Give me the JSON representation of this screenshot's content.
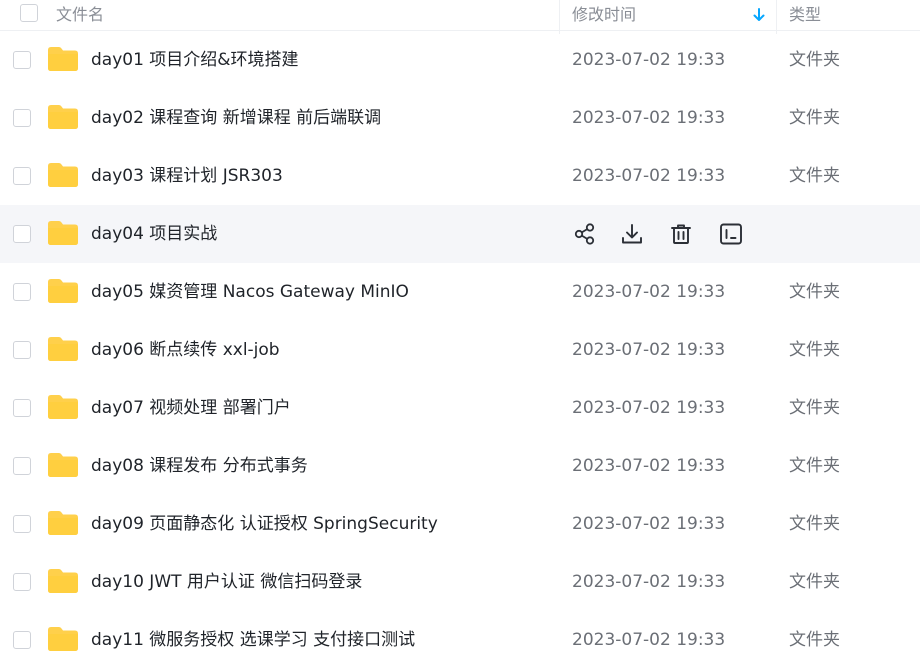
{
  "header": {
    "name_label": "文件名",
    "time_label": "修改时间",
    "type_label": "类型",
    "sort_icon": "arrow-down-icon",
    "accent": "#06a7ff"
  },
  "folder_color": "#ffd04b",
  "files": [
    {
      "name": "day01 项目介绍&环境搭建",
      "time": "2023-07-02 19:33",
      "type": "文件夹"
    },
    {
      "name": "day02 课程查询 新增课程 前后端联调",
      "time": "2023-07-02 19:33",
      "type": "文件夹"
    },
    {
      "name": "day03 课程计划  JSR303",
      "time": "2023-07-02 19:33",
      "type": "文件夹"
    },
    {
      "name": "day04 项目实战",
      "time": "",
      "type": "",
      "hovered": true
    },
    {
      "name": "day05 媒资管理 Nacos Gateway MinIO",
      "time": "2023-07-02 19:33",
      "type": "文件夹"
    },
    {
      "name": "day06 断点续传 xxl-job",
      "time": "2023-07-02 19:33",
      "type": "文件夹"
    },
    {
      "name": "day07 视频处理 部署门户",
      "time": "2023-07-02 19:33",
      "type": "文件夹"
    },
    {
      "name": "day08 课程发布 分布式事务",
      "time": "2023-07-02 19:33",
      "type": "文件夹"
    },
    {
      "name": "day09 页面静态化 认证授权 SpringSecurity",
      "time": "2023-07-02 19:33",
      "type": "文件夹"
    },
    {
      "name": "day10 JWT 用户认证 微信扫码登录",
      "time": "2023-07-02 19:33",
      "type": "文件夹"
    },
    {
      "name": "day11 微服务授权 选课学习 支付接口测试",
      "time": "2023-07-02 19:33",
      "type": "文件夹"
    }
  ],
  "hover_actions": [
    "share-icon",
    "download-icon",
    "delete-icon",
    "terminal-icon"
  ]
}
